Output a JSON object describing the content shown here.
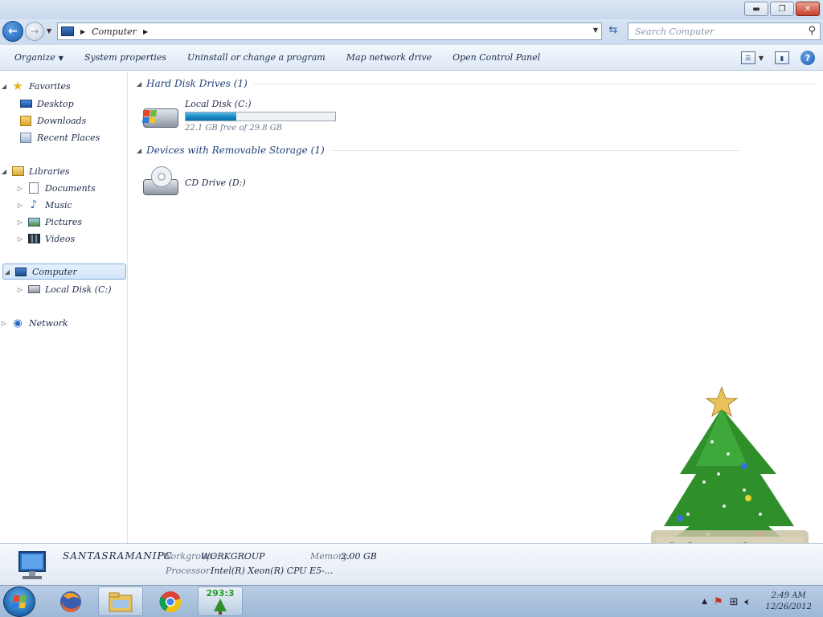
{
  "window": {
    "buttons": {
      "minimize": "▬",
      "maximize": "❐",
      "close": "✕"
    }
  },
  "address": {
    "back_glyph": "←",
    "forward_glyph": "→",
    "crumb": "Computer",
    "search_placeholder": "Search Computer"
  },
  "toolbar": {
    "organize": "Organize",
    "system_properties": "System properties",
    "uninstall": "Uninstall or change a program",
    "map_drive": "Map network drive",
    "control_panel": "Open Control Panel"
  },
  "nav": {
    "favorites": "Favorites",
    "desktop": "Desktop",
    "downloads": "Downloads",
    "recent": "Recent Places",
    "libraries": "Libraries",
    "documents": "Documents",
    "music": "Music",
    "pictures": "Pictures",
    "videos": "Videos",
    "computer": "Computer",
    "local_disk": "Local Disk (C:)",
    "network": "Network"
  },
  "content": {
    "hdd_group": "Hard Disk Drives (1)",
    "removable_group": "Devices with Removable Storage (1)",
    "c_drive": {
      "name": "Local Disk (C:)",
      "used_fraction": 0.34,
      "free_text": "22.1 GB free of 29.8 GB"
    },
    "d_drive": {
      "name": "CD Drive (D:)"
    }
  },
  "details": {
    "computer_name": "SANTASRAMANIPC",
    "workgroup_label": "Workgroup:",
    "workgroup_value": "WORKGROUP",
    "memory_label": "Memory:",
    "memory_value": "2.00 GB",
    "processor_label": "Processor:",
    "processor_value": "Intel(R) Xeon(R) CPU E5-..."
  },
  "taskbar": {
    "counter": "293:3",
    "time": "2:49 AM",
    "date": "12/26/2012"
  },
  "colors": {
    "accent": "#1b5fb4",
    "usage_bar": "#1a8bc6",
    "taskbar": "#9cb7d6"
  }
}
